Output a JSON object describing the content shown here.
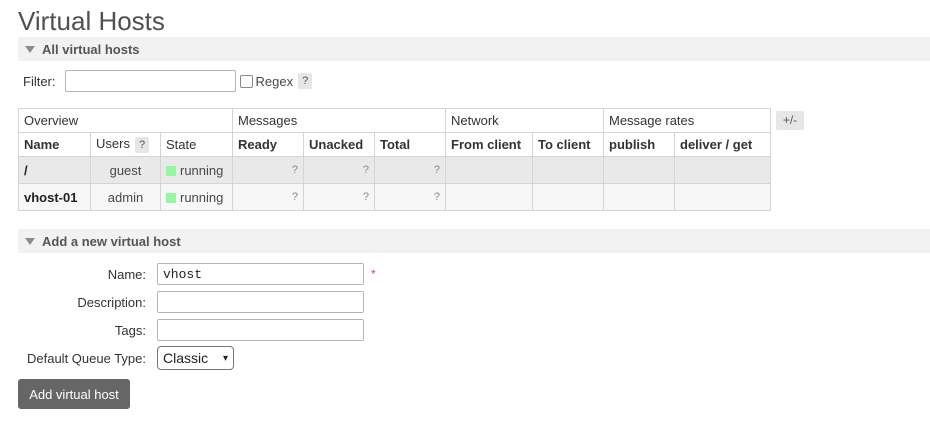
{
  "page_title": "Virtual Hosts",
  "all_section": {
    "title": "All virtual hosts"
  },
  "filter": {
    "label": "Filter:",
    "value": "",
    "regex_label": "Regex",
    "help": "?"
  },
  "table": {
    "groups": [
      "Overview",
      "Messages",
      "Network",
      "Message rates"
    ],
    "columns": {
      "name": "Name",
      "users": "Users",
      "users_help": "?",
      "state": "State",
      "ready": "Ready",
      "unacked": "Unacked",
      "total": "Total",
      "from_client": "From client",
      "to_client": "To client",
      "publish": "publish",
      "deliver_get": "deliver / get"
    },
    "plusminus": "+/-",
    "rows": [
      {
        "name": "/",
        "users": "guest",
        "state": "running",
        "ready": "?",
        "unacked": "?",
        "total": "?"
      },
      {
        "name": "vhost-01",
        "users": "admin",
        "state": "running",
        "ready": "?",
        "unacked": "?",
        "total": "?"
      }
    ]
  },
  "add_section": {
    "title": "Add a new virtual host"
  },
  "form": {
    "name_label": "Name:",
    "name_value": "vhost",
    "required_mark": "*",
    "description_label": "Description:",
    "description_value": "",
    "tags_label": "Tags:",
    "tags_value": "",
    "queue_type_label": "Default Queue Type:",
    "queue_type_value": "Classic",
    "submit_label": "Add virtual host"
  },
  "colors": {
    "running": "#98f5a3",
    "button": "#666666",
    "required": "#e03c3c"
  }
}
